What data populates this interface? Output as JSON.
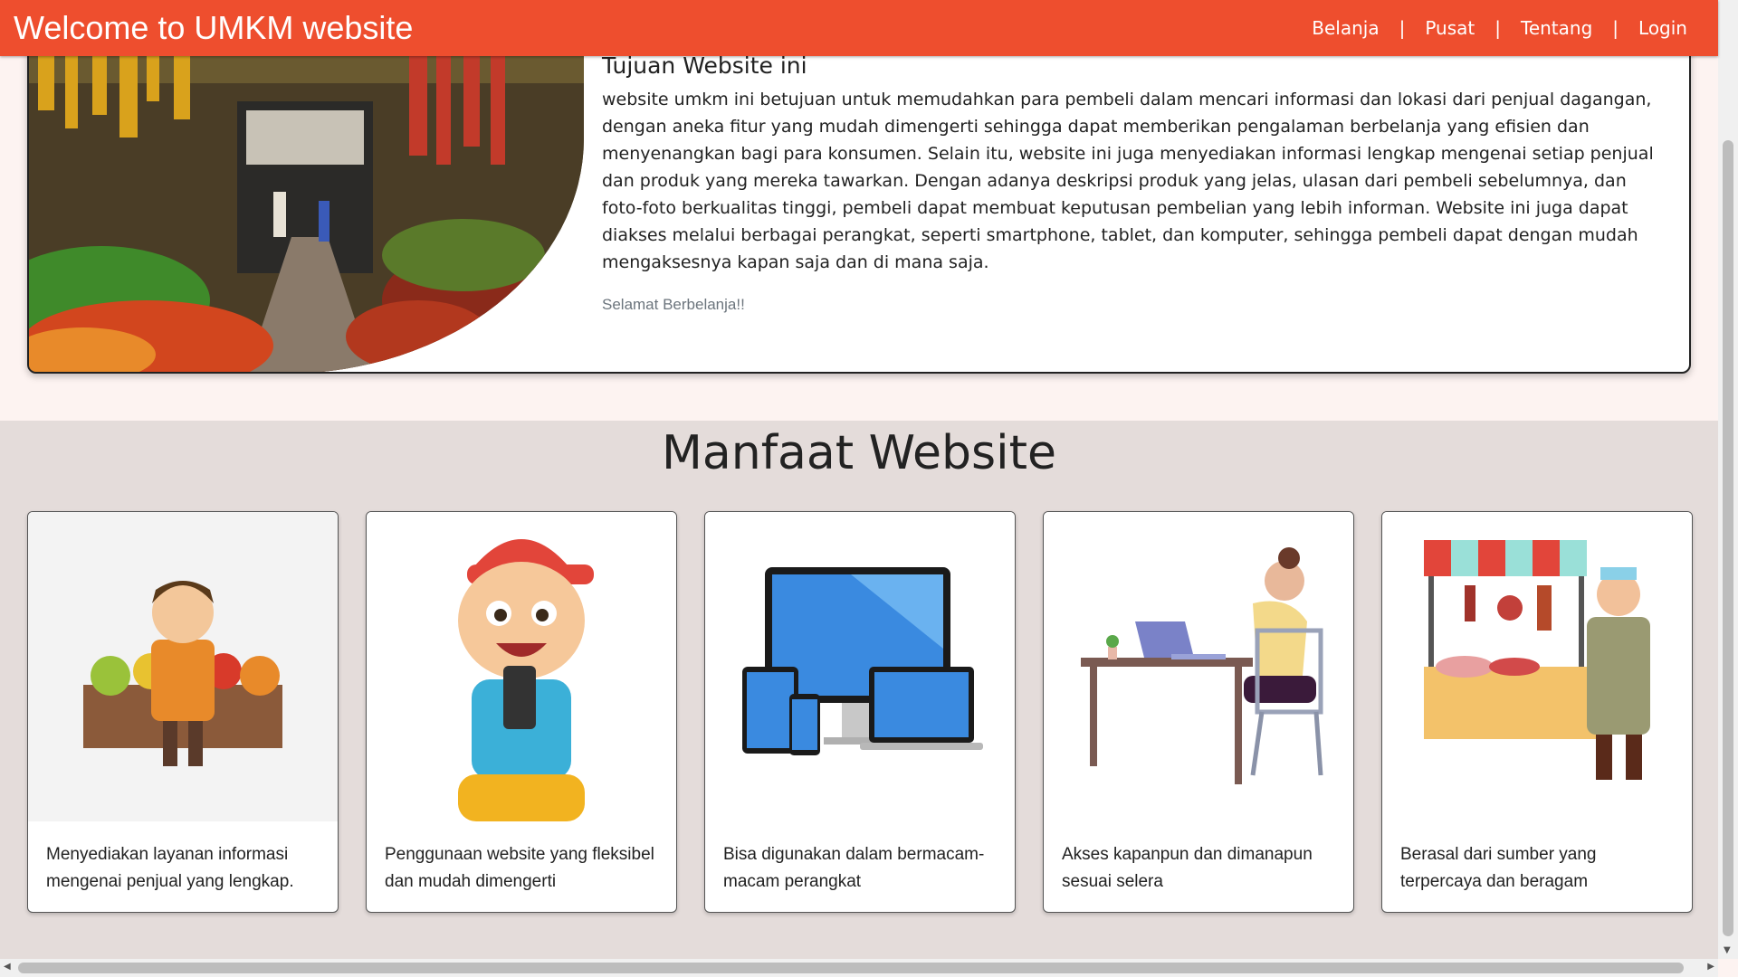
{
  "navbar": {
    "brand": "Welcome to UMKM website",
    "links": [
      {
        "label": "Belanja"
      },
      {
        "label": "Pusat"
      },
      {
        "label": "Tentang"
      },
      {
        "label": "Login"
      }
    ],
    "separator": "|",
    "background_color": "#ee4e2e"
  },
  "hero": {
    "image": "market-stall-photo",
    "title": "Tujuan Website ini",
    "body": "website umkm ini betujuan untuk memudahkan para pembeli dalam mencari informasi dan lokasi dari penjual dagangan, dengan aneka fitur yang mudah dimengerti sehingga dapat memberikan pengalaman berbelanja yang efisien dan menyenangkan bagi para konsumen. Selain itu, website ini juga menyediakan informasi lengkap mengenai setiap penjual dan produk yang mereka tawarkan. Dengan adanya deskripsi produk yang jelas, ulasan dari pembeli sebelumnya, dan foto-foto berkualitas tinggi, pembeli dapat membuat keputusan pembelian yang lebih informan. Website ini juga dapat diakses melalui berbagai perangkat, seperti smartphone, tablet, dan komputer, sehingga pembeli dapat dengan mudah mengaksesnya kapan saja dan di mana saja.",
    "greeting": "Selamat Berbelanja!!"
  },
  "benefits": {
    "title": "Manfaat Website",
    "cards": [
      {
        "image": "vendor-illustration",
        "text": "Menyediakan layanan informasi mengenai penjual yang lengkap."
      },
      {
        "image": "boy-with-phone-illustration",
        "text": "Penggunaan website yang fleksibel dan mudah dimengerti"
      },
      {
        "image": "devices-illustration",
        "text": "Bisa digunakan dalam bermacam-macam perangkat"
      },
      {
        "image": "woman-at-laptop-illustration",
        "text": "Akses kapanpun dan dimanapun sesuai selera"
      },
      {
        "image": "butcher-stall-illustration",
        "text": "Berasal dari sumber yang terpercaya dan beragam"
      }
    ]
  }
}
